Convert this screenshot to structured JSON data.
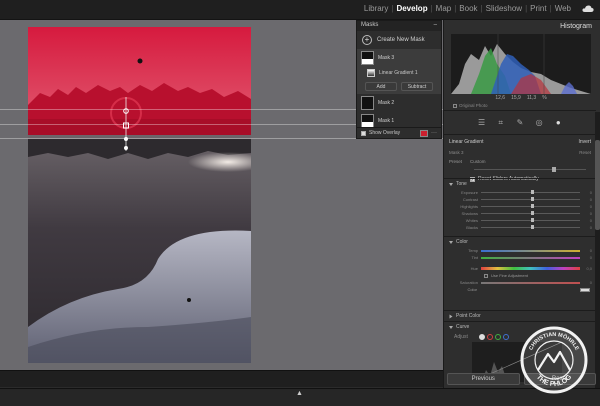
{
  "app": {
    "modules": [
      "Library",
      "Develop",
      "Map",
      "Book",
      "Slideshow",
      "Print",
      "Web"
    ],
    "active_module": "Develop"
  },
  "masks_panel": {
    "title": "Masks",
    "create_new_mask": "Create New Mask",
    "masks": [
      {
        "name": "Mask 3",
        "selected": true
      },
      {
        "name": "Mask 2",
        "selected": false
      },
      {
        "name": "Mask 1",
        "selected": false
      }
    ],
    "submask": "Linear Gradient 1",
    "add_label": "Add",
    "subtract_label": "Subtract",
    "show_overlay_label": "Show Overlay",
    "overlay_color": "#cc1f2e"
  },
  "histogram": {
    "title": "Histogram",
    "exif": [
      "12,6",
      "15,9",
      "11,3",
      "%"
    ],
    "original_photo_label": "Original Photo"
  },
  "mask_properties": {
    "tool_name": "Linear Gradient",
    "invert_label": "Invert",
    "mask_name": "Mask 3",
    "reset_label": "Reset",
    "preset_label": "Preset",
    "preset_value": "Custom",
    "amount_label": "Amount",
    "reset_sliders_label": "Reset Sliders Automatically"
  },
  "tone_section": {
    "title": "Tone",
    "sliders": [
      {
        "label": "Exposure",
        "value": "0"
      },
      {
        "label": "Contrast",
        "value": "0"
      },
      {
        "label": "Highlights",
        "value": "0"
      },
      {
        "label": "Shadows",
        "value": "0"
      },
      {
        "label": "Whites",
        "value": "0"
      },
      {
        "label": "Blacks",
        "value": "0"
      }
    ]
  },
  "color_section": {
    "title": "Color",
    "sliders": [
      {
        "label": "Temp",
        "value": "0",
        "kind": "temp"
      },
      {
        "label": "Tint",
        "value": "0",
        "kind": "tint"
      },
      {
        "label": "Hue",
        "value": "0,0",
        "kind": "hue"
      },
      {
        "label": "Saturation",
        "value": "0",
        "kind": "sat"
      }
    ],
    "fine_adjust_label": "Use Fine Adjustment",
    "color_label": "Color"
  },
  "point_color_section": {
    "title": "Point Color"
  },
  "curve_section": {
    "title": "Curve",
    "channel_label": "Adjust"
  },
  "buttons": {
    "previous": "Previous",
    "reset": "Reset"
  },
  "watermark": {
    "top_text": "CHRISTIAN MÖHRLE",
    "bottom_text": "THE PHLOG"
  },
  "filmstrip": {
    "toggle_glyph": "▲"
  }
}
